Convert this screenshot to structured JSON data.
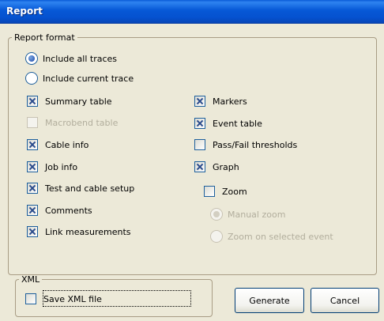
{
  "window": {
    "title": "Report"
  },
  "report_format": {
    "legend": "Report format",
    "trace_options": [
      {
        "label": "Include all traces",
        "selected": true
      },
      {
        "label": "Include current trace",
        "selected": false
      }
    ],
    "left_checks": [
      {
        "label": "Summary table",
        "checked": true,
        "enabled": true
      },
      {
        "label": "Macrobend table",
        "checked": false,
        "enabled": false
      },
      {
        "label": "Cable info",
        "checked": true,
        "enabled": true
      },
      {
        "label": "Job info",
        "checked": true,
        "enabled": true
      },
      {
        "label": "Test and cable setup",
        "checked": true,
        "enabled": true
      },
      {
        "label": "Comments",
        "checked": true,
        "enabled": true
      },
      {
        "label": "Link measurements",
        "checked": true,
        "enabled": true
      }
    ],
    "right_checks": [
      {
        "label": "Markers",
        "checked": true,
        "enabled": true
      },
      {
        "label": "Event table",
        "checked": true,
        "enabled": true
      },
      {
        "label": "Pass/Fail thresholds",
        "checked": false,
        "enabled": true
      },
      {
        "label": "Graph",
        "checked": true,
        "enabled": true
      }
    ],
    "zoom": {
      "label": "Zoom",
      "checked": false,
      "enabled": true
    },
    "zoom_options": [
      {
        "label": "Manual zoom",
        "selected": true,
        "enabled": false
      },
      {
        "label": "Zoom on selected event",
        "selected": false,
        "enabled": false
      }
    ]
  },
  "xml": {
    "legend": "XML",
    "save_label": "Save XML file",
    "checked": false
  },
  "buttons": {
    "generate": "Generate",
    "cancel": "Cancel"
  }
}
